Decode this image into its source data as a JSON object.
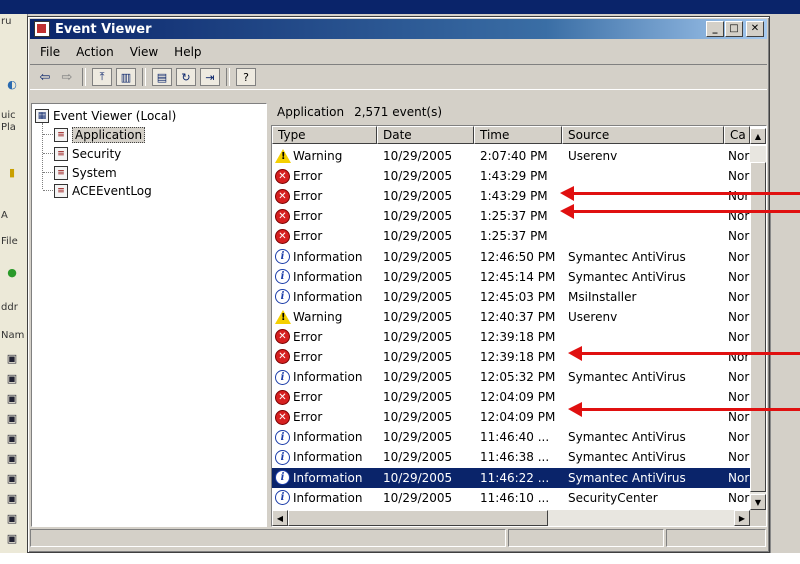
{
  "window": {
    "title": "Event Viewer"
  },
  "menu": [
    "File",
    "Action",
    "View",
    "Help"
  ],
  "tree": {
    "root": "Event Viewer (Local)",
    "children": [
      "Application",
      "Security",
      "System",
      "ACEEventLog"
    ],
    "selected": "Application"
  },
  "list": {
    "log_name": "Application",
    "event_count": "2,571 event(s)",
    "columns": [
      "Type",
      "Date",
      "Time",
      "Source",
      "Ca"
    ],
    "rows": [
      {
        "type": "Warning",
        "date": "10/29/2005",
        "time": "2:07:40 PM",
        "source": "Userenv",
        "cat": "Nor"
      },
      {
        "type": "Error",
        "date": "10/29/2005",
        "time": "1:43:29 PM",
        "source": "",
        "cat": "Nor"
      },
      {
        "type": "Error",
        "date": "10/29/2005",
        "time": "1:43:29 PM",
        "source": "",
        "cat": "Nor"
      },
      {
        "type": "Error",
        "date": "10/29/2005",
        "time": "1:25:37 PM",
        "source": "",
        "cat": "Nor"
      },
      {
        "type": "Error",
        "date": "10/29/2005",
        "time": "1:25:37 PM",
        "source": "",
        "cat": "Nor"
      },
      {
        "type": "Information",
        "date": "10/29/2005",
        "time": "12:46:50 PM",
        "source": "Symantec AntiVirus",
        "cat": "Nor"
      },
      {
        "type": "Information",
        "date": "10/29/2005",
        "time": "12:45:14 PM",
        "source": "Symantec AntiVirus",
        "cat": "Nor"
      },
      {
        "type": "Information",
        "date": "10/29/2005",
        "time": "12:45:03 PM",
        "source": "MsiInstaller",
        "cat": "Nor"
      },
      {
        "type": "Warning",
        "date": "10/29/2005",
        "time": "12:40:37 PM",
        "source": "Userenv",
        "cat": "Nor"
      },
      {
        "type": "Error",
        "date": "10/29/2005",
        "time": "12:39:18 PM",
        "source": "",
        "cat": "Nor"
      },
      {
        "type": "Error",
        "date": "10/29/2005",
        "time": "12:39:18 PM",
        "source": "",
        "cat": "Nor"
      },
      {
        "type": "Information",
        "date": "10/29/2005",
        "time": "12:05:32 PM",
        "source": "Symantec AntiVirus",
        "cat": "Nor"
      },
      {
        "type": "Error",
        "date": "10/29/2005",
        "time": "12:04:09 PM",
        "source": "",
        "cat": "Nor"
      },
      {
        "type": "Error",
        "date": "10/29/2005",
        "time": "12:04:09 PM",
        "source": "",
        "cat": "Nor"
      },
      {
        "type": "Information",
        "date": "10/29/2005",
        "time": "11:46:40 ...",
        "source": "Symantec AntiVirus",
        "cat": "Nor"
      },
      {
        "type": "Information",
        "date": "10/29/2005",
        "time": "11:46:38 ...",
        "source": "Symantec AntiVirus",
        "cat": "Nor"
      },
      {
        "type": "Information",
        "date": "10/29/2005",
        "time": "11:46:22 ...",
        "source": "Symantec AntiVirus",
        "cat": "Nor",
        "selected": true
      },
      {
        "type": "Information",
        "date": "10/29/2005",
        "time": "11:46:10 ...",
        "source": "SecurityCenter",
        "cat": "Nor"
      }
    ]
  },
  "background": {
    "left_labels": [
      "ru",
      "uic",
      "Pla",
      "A",
      "File",
      "ddr",
      "Nam"
    ]
  },
  "colors": {
    "titlebar": "#0a246a",
    "selection": "#0a246a",
    "annotation_arrow": "#e01010"
  }
}
